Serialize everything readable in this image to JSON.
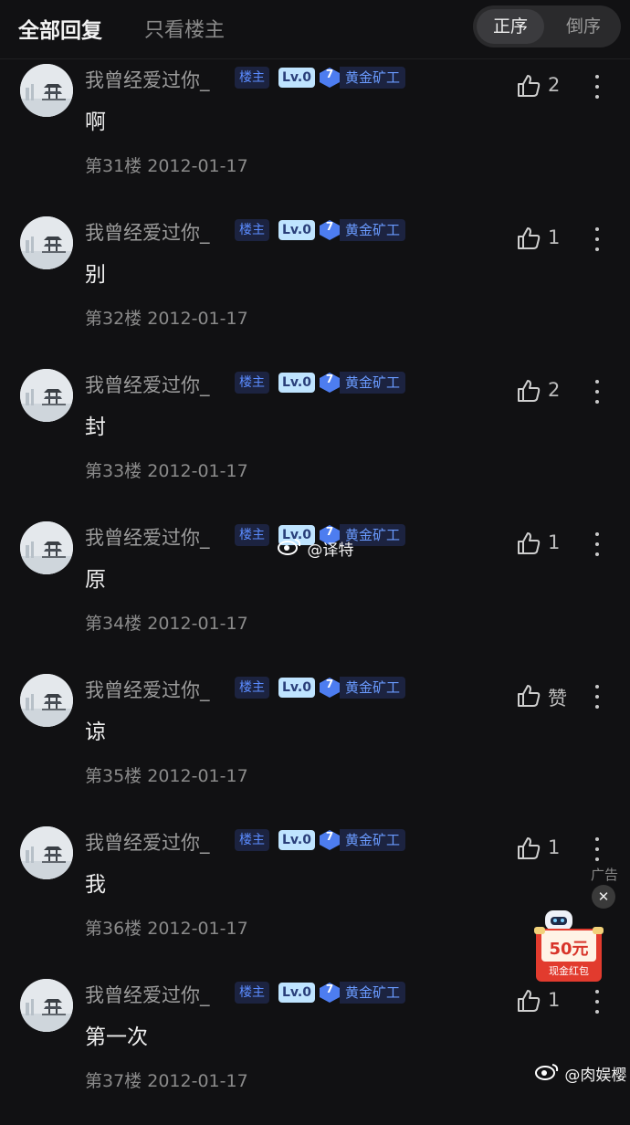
{
  "header": {
    "tab_all": "全部回复",
    "tab_op_only": "只看楼主",
    "sort_asc": "正序",
    "sort_desc": "倒序"
  },
  "posts": [
    {
      "username": "我曾经爱过你_",
      "op_tag": "楼主",
      "level": "Lv.0",
      "rank_number": "7",
      "rank_title": "黄金矿工",
      "content": "啊",
      "floor": "第31楼",
      "date": "2012-01-17",
      "likes": "2"
    },
    {
      "username": "我曾经爱过你_",
      "op_tag": "楼主",
      "level": "Lv.0",
      "rank_number": "7",
      "rank_title": "黄金矿工",
      "content": "别",
      "floor": "第32楼",
      "date": "2012-01-17",
      "likes": "1"
    },
    {
      "username": "我曾经爱过你_",
      "op_tag": "楼主",
      "level": "Lv.0",
      "rank_number": "7",
      "rank_title": "黄金矿工",
      "content": "封",
      "floor": "第33楼",
      "date": "2012-01-17",
      "likes": "2"
    },
    {
      "username": "我曾经爱过你_",
      "op_tag": "楼主",
      "level": "Lv.0",
      "rank_number": "7",
      "rank_title": "黄金矿工",
      "content": "原",
      "floor": "第34楼",
      "date": "2012-01-17",
      "likes": "1"
    },
    {
      "username": "我曾经爱过你_",
      "op_tag": "楼主",
      "level": "Lv.0",
      "rank_number": "7",
      "rank_title": "黄金矿工",
      "content": "谅",
      "floor": "第35楼",
      "date": "2012-01-17",
      "likes": "赞"
    },
    {
      "username": "我曾经爱过你_",
      "op_tag": "楼主",
      "level": "Lv.0",
      "rank_number": "7",
      "rank_title": "黄金矿工",
      "content": "我",
      "floor": "第36楼",
      "date": "2012-01-17",
      "likes": "1"
    },
    {
      "username": "我曾经爱过你_",
      "op_tag": "楼主",
      "level": "Lv.0",
      "rank_number": "7",
      "rank_title": "黄金矿工",
      "content": "第一次",
      "floor": "第37楼",
      "date": "2012-01-17",
      "likes": "1"
    }
  ],
  "watermarks": {
    "center": "@译特",
    "bottom": "@肉娱樱"
  },
  "ad": {
    "label": "广告",
    "close": "✕",
    "amount": "50元",
    "caption": "现金红包"
  },
  "colors": {
    "background": "#111113",
    "op_tag": "#5b8cff",
    "level_badge": "#bfe4ff",
    "rank_gem": "#4d7df0",
    "ad_red": "#e23b2e"
  },
  "icons": {
    "like": "thumbs-up-icon",
    "more": "more-vertical-icon",
    "weibo": "weibo-logo-icon"
  }
}
